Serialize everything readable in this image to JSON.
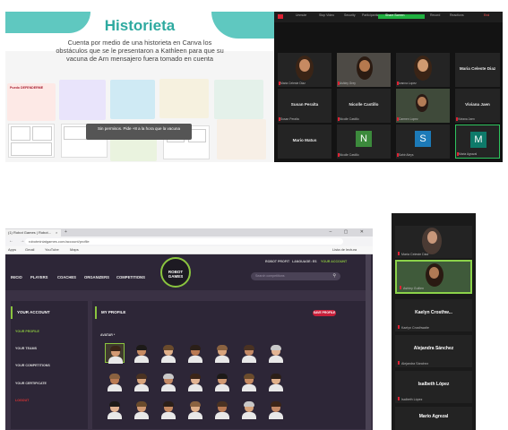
{
  "canva": {
    "title": "Historieta",
    "description": "Cuenta por medio de una historieta en Canva los obstáculos que se le presentaron a Kathleen para que su vacuna de Arn mensajero fuera tomado en cuenta",
    "thumb_label": "Puedo DEFENDERME",
    "tooltip": "Sin permisos. Pide +8 a la hora que la vacuna"
  },
  "zoom_gallery": {
    "toolbar": [
      "Unmute",
      "Stop Video",
      "Security",
      "Participants",
      "Chat",
      "Share Screen",
      "Record",
      "Reactions",
      "End"
    ],
    "tiles": [
      {
        "name": "",
        "label": "Maria Celeste Diaz"
      },
      {
        "name": "",
        "label": "Ashley Grey"
      },
      {
        "name": "",
        "label": "Ivanna Lopez"
      },
      {
        "name": "Maria Celeste Diaz",
        "label": "Maria Celeste Diaz"
      },
      {
        "name": "Susan Peralta",
        "label": "Susan Peralta"
      },
      {
        "name": "Nicolle Castillo",
        "label": "Nicolle Castillo"
      },
      {
        "name": "",
        "label": "Carmen Lopez"
      },
      {
        "name": "Viviana Jaen",
        "label": "Viviana Jaen"
      },
      {
        "name": "Mario Matus",
        "label": "Mario Matus"
      },
      {
        "name": "N",
        "label": "Nicolle Castillo"
      },
      {
        "name": "S",
        "label": "Sahir Aleys"
      },
      {
        "name": "M",
        "label": "Maria Agrazal"
      }
    ]
  },
  "browser": {
    "tab_title": "(1) Robot Games | Robot...",
    "tab_close": "×",
    "new_tab": "+",
    "window_controls": "– ▢ ✕",
    "nav_icons": "← → ⟳",
    "url": "robotminiatgames.com/account/profile",
    "bookmarks": [
      "Apps",
      "Gmail",
      "YouTube",
      "Maps"
    ],
    "reading_list": "Lista de lectura"
  },
  "site": {
    "logo": "ROBOT GAMES",
    "top_links": [
      "ROBOT PROFIT",
      "LANGUAGE: ES",
      "YOUR ACCOUNT"
    ],
    "nav": [
      "INICIO",
      "PLAYERS",
      "COACHES",
      "ORGANIZERS",
      "COMPETITIONS"
    ],
    "search_placeholder": "Search competitions",
    "search_icon": "⚲",
    "left_head": "YOUR ACCOUNT",
    "left_items": [
      "YOUR PROFILE",
      "YOUR TEAMS",
      "YOUR COMPETITIONS",
      "YOUR CERTIFICATE",
      "LOGOUT"
    ],
    "main_head": "MY PROFILE",
    "save": "SAVE PROFILE",
    "avatar_label": "AVATAR *"
  },
  "zoom_sidebar": {
    "tiles": [
      {
        "name": "",
        "label": "Maria Celeste Diaz"
      },
      {
        "name": "",
        "label": "Ashley Guillen"
      },
      {
        "name": "Kaelyn Crosthw...",
        "label": "Kaelyn Crosthwaite"
      },
      {
        "name": "Alejandra Sánchez",
        "label": "Alejandra Sánchez"
      },
      {
        "name": "Isalbeth López",
        "label": "Isalbeth López"
      },
      {
        "name": "Mario Agrezal",
        "label": "Mario Agrezal"
      }
    ]
  },
  "colors": {
    "canva_teal": "#5fc8c0",
    "zoom_dark": "#131313",
    "robot_accent": "#8ac43f",
    "save_red": "#c81f3a",
    "zoom_green": "#20b040",
    "letter_n": "#3c8a3c",
    "letter_s": "#1c7ab8",
    "letter_m": "#0e7a6a"
  }
}
